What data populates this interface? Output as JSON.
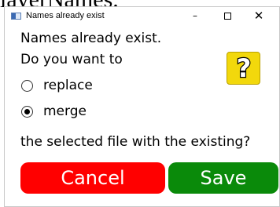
{
  "background_text": "layerNames.",
  "window": {
    "title": "Names already exist",
    "controls": {
      "minimize": "–",
      "close": "✕"
    }
  },
  "dialog": {
    "message_line1": "Names already exist.",
    "message_line2": "Do you want to",
    "options": [
      {
        "label": "replace",
        "selected": false
      },
      {
        "label": "merge",
        "selected": true
      }
    ],
    "message_line3": "the selected file with the existing?",
    "icon": "question-mark-icon",
    "icon_color": "#f2d80c"
  },
  "buttons": {
    "cancel_label": "Cancel",
    "save_label": "Save",
    "cancel_color": "#ff0000",
    "save_color": "#0a8a0a"
  }
}
